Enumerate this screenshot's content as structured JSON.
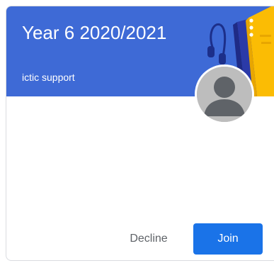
{
  "card": {
    "class_title": "Year 6 2020/2021",
    "teacher_name": "ictic support"
  },
  "icons": {
    "banner_illustration": "headphones-and-books-illustration",
    "more": "more-vert-icon",
    "avatar": "default-profile-icon"
  },
  "actions": {
    "decline_label": "Decline",
    "join_label": "Join"
  },
  "colors": {
    "banner": "#3e6ad6",
    "join_button": "#1a73e8",
    "decline_text": "#5f6368",
    "avatar_bg": "#bdbdbd",
    "avatar_fg": "#5f6368"
  }
}
